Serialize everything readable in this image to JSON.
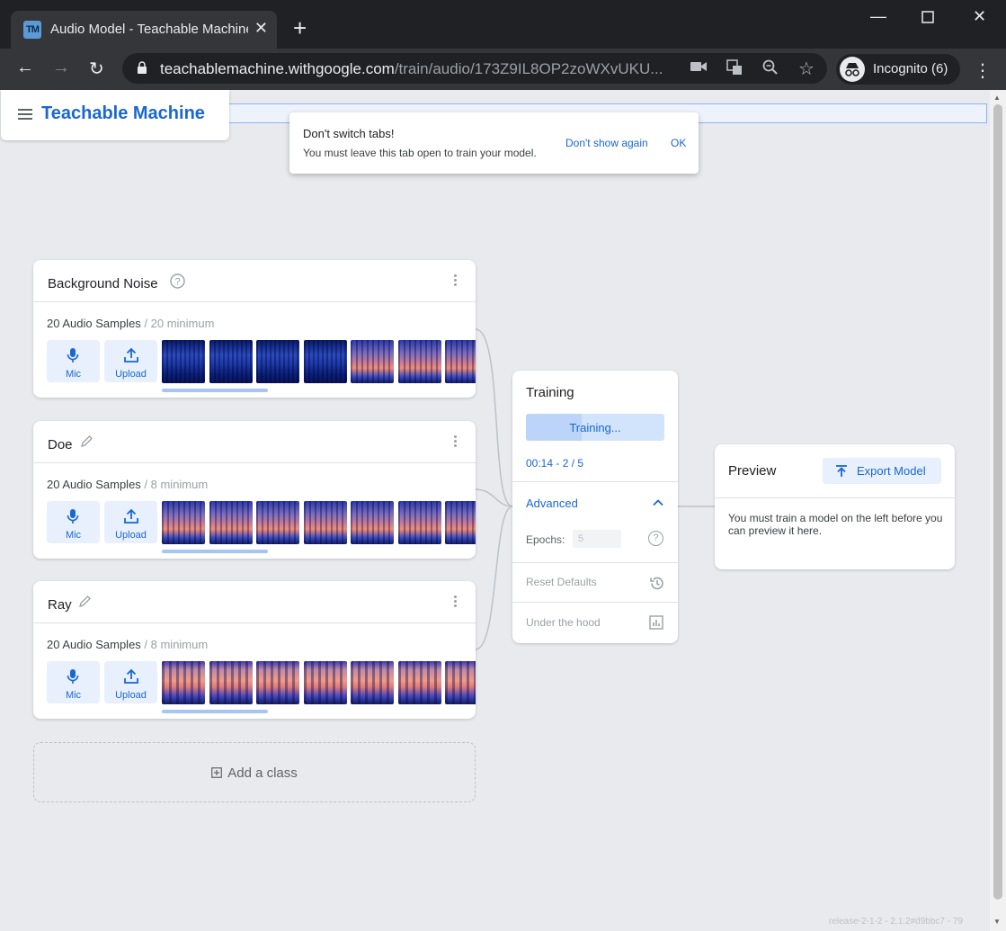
{
  "browser": {
    "tab_title": "Audio Model - Teachable Machine",
    "favicon_text": "TM",
    "url_host": "teachablemachine.withgoogle.com",
    "url_path": "/train/audio/173Z9IL8OP2zoWXvUKU...",
    "profile_label": "Incognito (6)"
  },
  "app": {
    "brand": "Teachable Machine"
  },
  "toast": {
    "title": "Don't switch tabs!",
    "message": "You must leave this tab open to train your model.",
    "dont_show": "Don't show again",
    "ok": "OK"
  },
  "classes": [
    {
      "name": "Background Noise",
      "count": "20 Audio Samples",
      "min": " / 20 minimum",
      "mic": "Mic",
      "upload": "Upload"
    },
    {
      "name": "Doe",
      "count": "20 Audio Samples",
      "min": " / 8 minimum",
      "mic": "Mic",
      "upload": "Upload"
    },
    {
      "name": "Ray",
      "count": "20 Audio Samples",
      "min": " / 8 minimum",
      "mic": "Mic",
      "upload": "Upload"
    }
  ],
  "add_class": "Add a class",
  "training": {
    "title": "Training",
    "button": "Training...",
    "progress": 0.4,
    "time": "00:14 - 2 / 5",
    "advanced": "Advanced",
    "epochs_label": "Epochs:",
    "epochs_value": "5",
    "reset": "Reset Defaults",
    "under_hood": "Under the hood"
  },
  "preview": {
    "title": "Preview",
    "export": "Export Model",
    "message": "You must train a model on the left before you can preview it here."
  },
  "release": "release-2-1-2 - 2.1.2#d9bbc7 - 79",
  "colors": {
    "accent": "#1967d2",
    "accent_light": "#e8f0fe",
    "page_bg": "#e8eaed"
  }
}
